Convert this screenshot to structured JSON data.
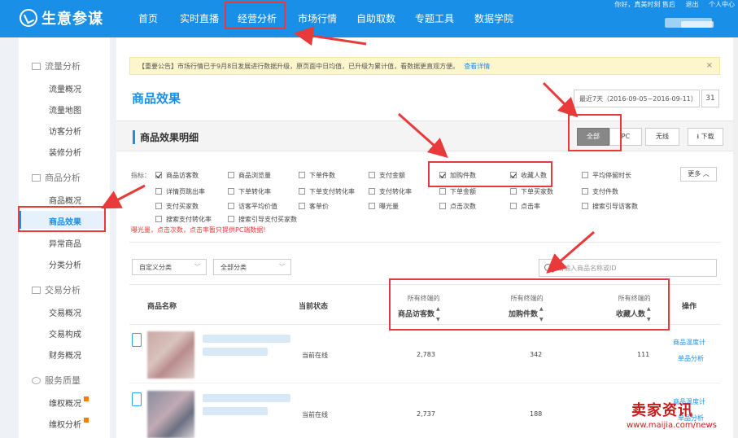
{
  "app": {
    "name": "生意参谋"
  },
  "topnav": {
    "items": [
      "首页",
      "实时直播",
      "经营分析",
      "市场行情",
      "自助取数",
      "专题工具",
      "数据学院"
    ],
    "active_index": 2,
    "user_links": [
      "你好，真美时刻 售后",
      "退出",
      "个人中心"
    ]
  },
  "sidebar": {
    "groups": [
      {
        "label": "流量分析",
        "items": [
          "流量概况",
          "流量地图",
          "访客分析",
          "装修分析"
        ]
      },
      {
        "label": "商品分析",
        "items": [
          "商品概况",
          "商品效果",
          "异常商品",
          "分类分析"
        ]
      },
      {
        "label": "交易分析",
        "items": [
          "交易概况",
          "交易构成",
          "财务概况"
        ]
      },
      {
        "label": "服务质量",
        "items": [
          "维权概况",
          "维权分析"
        ]
      }
    ],
    "active_item": "商品效果"
  },
  "notice": {
    "text": "【重要公告】市场行情已于9月8日发展进行数据升级，原页面中日均值，已升级为累计值，看数据更直观方便。",
    "link": "查看详情",
    "close": "×"
  },
  "page": {
    "title": "商品效果",
    "date_range": "最近7天（2016-09-05~2016-09-11）",
    "calendar_label": "31"
  },
  "section": {
    "title": "商品效果明细",
    "segments": [
      "全部",
      "PC",
      "无线"
    ],
    "active_segment": "全部",
    "download": "下载"
  },
  "metrics": {
    "label": "指标：",
    "rows": [
      [
        {
          "label": "商品访客数",
          "checked": true
        },
        {
          "label": "商品浏览量",
          "checked": false
        },
        {
          "label": "下单件数",
          "checked": false
        },
        {
          "label": "支付金额",
          "checked": false
        },
        {
          "label": "加购件数",
          "checked": true
        },
        {
          "label": "收藏人数",
          "checked": true
        },
        {
          "label": "平均停留时长",
          "checked": false
        }
      ],
      [
        {
          "label": "详情页跳出率",
          "checked": false
        },
        {
          "label": "下单转化率",
          "checked": false
        },
        {
          "label": "下单支付转化率",
          "checked": false
        },
        {
          "label": "支付转化率",
          "checked": false
        },
        {
          "label": "下单金额",
          "checked": false
        },
        {
          "label": "下单买家数",
          "checked": false
        },
        {
          "label": "支付件数",
          "checked": false
        }
      ],
      [
        {
          "label": "支付买家数",
          "checked": false
        },
        {
          "label": "访客平均价值",
          "checked": false
        },
        {
          "label": "客单价",
          "checked": false
        },
        {
          "label": "曝光量",
          "checked": false
        },
        {
          "label": "点击次数",
          "checked": false
        },
        {
          "label": "点击率",
          "checked": false
        },
        {
          "label": "搜索引导访客数",
          "checked": false
        }
      ],
      [
        {
          "label": "搜索支付转化率",
          "checked": false
        },
        {
          "label": "搜索引导支付买家数",
          "checked": false
        }
      ]
    ],
    "more": "更多",
    "warning": "曝光量，点击次数，点击率暂只提供PC端数据!"
  },
  "filters": {
    "custom_category": "自定义分类",
    "all_category": "全部分类",
    "search_placeholder": "请输入商品名称或ID"
  },
  "table": {
    "columns": {
      "name": "商品名称",
      "status": "当前状态",
      "visitors": [
        "所有终端的",
        "商品访客数"
      ],
      "cart": [
        "所有终端的",
        "加购件数"
      ],
      "fav": [
        "所有终端的",
        "收藏人数"
      ],
      "ops": "操作"
    },
    "rows": [
      {
        "status": "当前在线",
        "visitors": "2,783",
        "cart": "342",
        "fav": "111",
        "ops": [
          "商品温度计",
          "单品分析"
        ]
      },
      {
        "status": "当前在线",
        "visitors": "2,737",
        "cart": "188",
        "fav": "",
        "ops": [
          "商品温度计",
          "单品分析"
        ]
      }
    ]
  },
  "watermark": {
    "text": "卖家资讯",
    "url": "www.maijia.com/news"
  },
  "colors": {
    "brand": "#1a8fe8",
    "highlight": "#e83a3a",
    "notice_bg": "#fdf5cc"
  }
}
